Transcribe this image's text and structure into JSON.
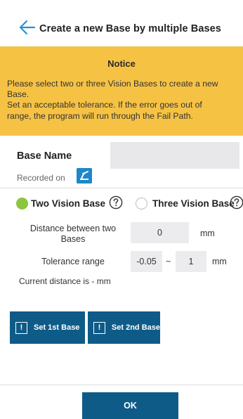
{
  "header": {
    "title": "Create a new Base by multiple Bases",
    "back_icon": "arrow-left-icon"
  },
  "notice": {
    "title": "Notice",
    "lines": [
      "Please select two or three Vision Bases to create a new",
      "Base.",
      "Set an acceptable tolerance. If the error goes out of",
      "range, the program will run through the Fail Path."
    ],
    "background_color": "#f6c244"
  },
  "base_name": {
    "label": "Base Name",
    "value": "",
    "recorded_label": "Recorded on",
    "recorded_icon": "robot-arm-icon"
  },
  "mode": {
    "options": [
      {
        "label": "Two Vision Base",
        "selected": true,
        "help_icon": "question-circle-icon"
      },
      {
        "label": "Three Vision Base",
        "selected": false,
        "help_icon": "question-circle-icon"
      }
    ],
    "selected_color": "#8cc63e"
  },
  "distance": {
    "label_line1": "Distance between two",
    "label_line2": "Bases",
    "value": "0",
    "unit": "mm"
  },
  "tolerance": {
    "label": "Tolerance range",
    "min": "-0.05",
    "separator": "~",
    "max": "1",
    "unit": "mm"
  },
  "current_distance": "Current distance is -  mm",
  "buttons": {
    "set_1st": "Set 1st Base",
    "set_2nd": "Set 2nd Base",
    "set_icon_glyph": "!",
    "ok": "OK",
    "primary_color": "#0e5b88"
  }
}
